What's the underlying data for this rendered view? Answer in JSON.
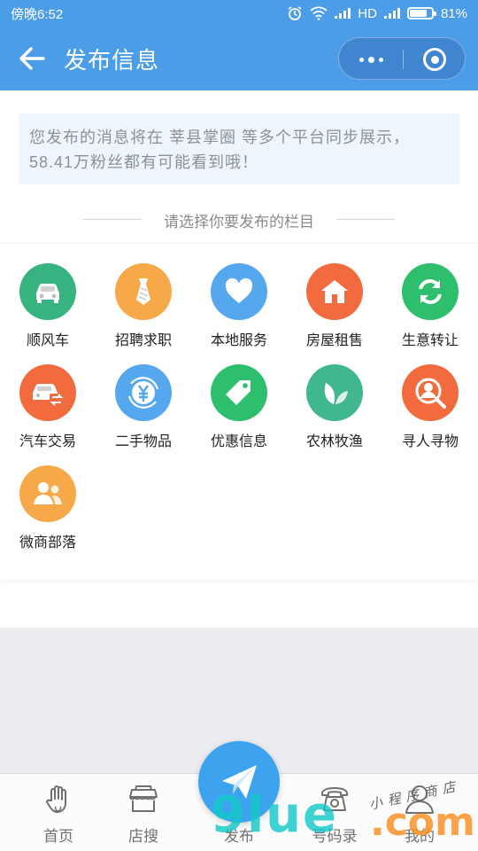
{
  "status_bar": {
    "time": "傍晚6:52",
    "network": "HD",
    "battery_percent_label": "81%",
    "battery_level": 0.81
  },
  "navbar": {
    "title": "发布信息"
  },
  "notice": {
    "text": "您发布的消息将在 莘县掌圈 等多个平台同步展示，58.41万粉丝都有可能看到哦！"
  },
  "section_title": "请选择你要发布的栏目",
  "categories": [
    {
      "label": "顺风车",
      "icon": "car-icon",
      "color": "#36b37e"
    },
    {
      "label": "招聘求职",
      "icon": "tie-icon",
      "color": "#f7a94a"
    },
    {
      "label": "本地服务",
      "icon": "heart-icon",
      "color": "#55a8ee"
    },
    {
      "label": "房屋租售",
      "icon": "house-icon",
      "color": "#f26b3e"
    },
    {
      "label": "生意转让",
      "icon": "refresh-icon",
      "color": "#2ebf6e"
    },
    {
      "label": "汽车交易",
      "icon": "car-exchange-icon",
      "color": "#f26b3e"
    },
    {
      "label": "二手物品",
      "icon": "yuan-recycle-icon",
      "color": "#55a8ee"
    },
    {
      "label": "优惠信息",
      "icon": "price-tag-icon",
      "color": "#2ebf6e"
    },
    {
      "label": "农林牧渔",
      "icon": "leaf-icon",
      "color": "#40b78c"
    },
    {
      "label": "寻人寻物",
      "icon": "person-search-icon",
      "color": "#f26b3e"
    },
    {
      "label": "微商部落",
      "icon": "people-icon",
      "color": "#f7a94a"
    }
  ],
  "tabbar": {
    "tabs": [
      {
        "label": "首页",
        "icon": "hand-icon"
      },
      {
        "label": "店搜",
        "icon": "store-icon"
      },
      {
        "label": "发布",
        "icon": "paper-plane-icon"
      },
      {
        "label": "号码录",
        "icon": "phone-icon"
      },
      {
        "label": "我的",
        "icon": "user-icon"
      }
    ]
  },
  "watermark": {
    "main": "9lue",
    "suffix": ".com",
    "tagline": "小程序商店"
  },
  "colors": {
    "primary": "#4c9de8",
    "notice_bg": "#eef5fd",
    "publish_button": "#3ea3ee"
  }
}
